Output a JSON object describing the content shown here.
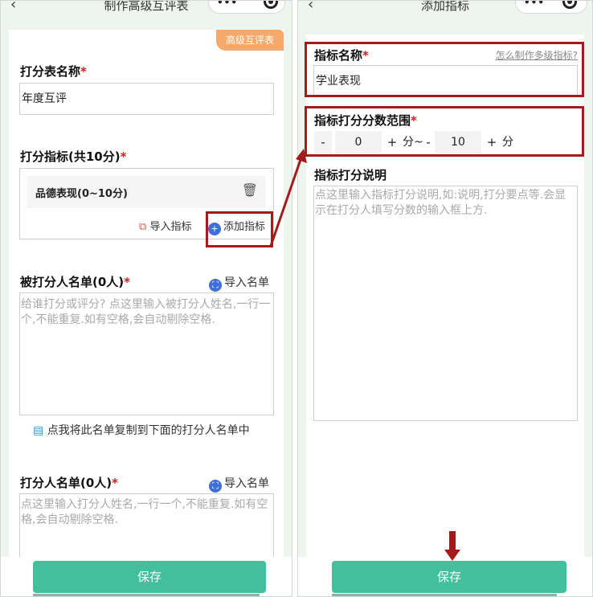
{
  "left": {
    "title": "制作高级互评表",
    "tag": "高级互评表",
    "sheet_name_label": "打分表名称",
    "sheet_name_value": "年度互评",
    "criteria_label": "打分指标(共10分)",
    "criterion_item": "品德表现(0~10分)",
    "import_criteria": "导入指标",
    "add_criteria": "添加指标",
    "ratee_label": "被打分人名单(0人)",
    "ratee_import": "导入名单",
    "ratee_placeholder": "给谁打分或评分? 点这里输入被打分人姓名,一行一个,不能重复.如有空格,会自动剔除空格.",
    "copy_hint": "点我将此名单复制到下面的打分人名单中",
    "rater_label": "打分人名单(0人)",
    "rater_import": "导入名单",
    "rater_placeholder": "点这里输入打分人姓名,一行一个,不能重复.如有空格,会自动剔除空格.",
    "save": "保存"
  },
  "right": {
    "title": "添加指标",
    "name_label": "指标名称",
    "help_link": "怎么制作多级指标?",
    "name_value": "学业表现",
    "range_label": "指标打分分数范围",
    "minus": "-",
    "plus": "+",
    "min_value": "0",
    "max_value": "10",
    "unit_mid": "分~",
    "unit_end": "分",
    "desc_label": "指标打分说明",
    "desc_placeholder": "点这里输入指标打分说明,如:说明,打分要点等.会显示在打分人填写分数的输入框上方.",
    "save": "保存"
  },
  "colors": {
    "accent": "#42bf9b",
    "highlight": "#a51b1b",
    "tag": "#f5a96b"
  }
}
